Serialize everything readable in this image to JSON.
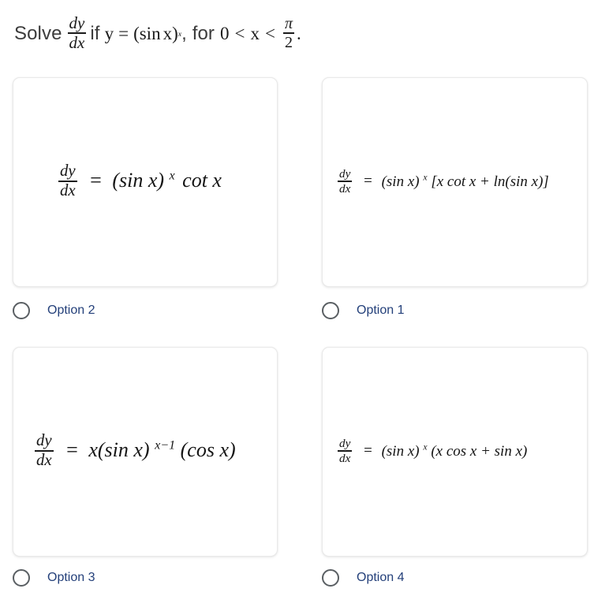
{
  "question": {
    "lead": "Solve",
    "frac_num": "dy",
    "frac_den": "dx",
    "mid": "if",
    "y": "y",
    "equals": "=",
    "open_paren": "(",
    "sin": "sin",
    "x1": "x",
    "close_paren": ")",
    "exp": "x",
    "comma_for": ", for",
    "zero": "0",
    "lt1": "<",
    "x2": "x",
    "lt2": "<",
    "pi": "π",
    "two": "2",
    "period": "."
  },
  "options": [
    {
      "id": "option-2",
      "label": "Option 2",
      "selected": false,
      "formula_text": "dy/dx = (sin x)^x cot x",
      "formula": {
        "num": "dy",
        "den": "dx",
        "eq": "=",
        "body": "(sin x)",
        "sup": "x",
        "tail": "cot x"
      }
    },
    {
      "id": "option-1",
      "label": "Option 1",
      "selected": false,
      "formula_text": "dy/dx = (sin x)^x[x cot x + ln(sin x)]",
      "formula": {
        "num": "dy",
        "den": "dx",
        "eq": "=",
        "body": "(sin x)",
        "sup": "x",
        "tail": "[x cot x + ln(sin x)]"
      }
    },
    {
      "id": "option-3",
      "label": "Option 3",
      "selected": false,
      "formula_text": "dy/dx = x(sin x)^(x-1)(cos x)",
      "formula": {
        "num": "dy",
        "den": "dx",
        "eq": "=",
        "body": "x(sin x)",
        "sup": "x−1",
        "tail": "(cos x)"
      }
    },
    {
      "id": "option-4",
      "label": "Option 4",
      "selected": false,
      "formula_text": "dy/dx = (sin x)^x(x cos x + sin x)",
      "formula": {
        "num": "dy",
        "den": "dx",
        "eq": "=",
        "body": "(sin x)",
        "sup": "x",
        "tail": "(x cos x + sin x)"
      }
    }
  ],
  "colors": {
    "page_background": "#ffffff",
    "card_background": "#ffffff",
    "card_border": "#e9e9e9",
    "question_text": "#3c3c3c",
    "math_text": "#151515",
    "option_label": "#24407a",
    "radio_stroke": "#5a5f63"
  }
}
